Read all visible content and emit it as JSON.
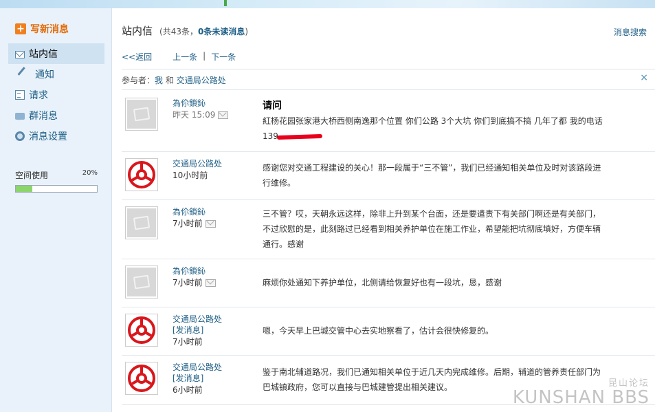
{
  "sidebar": {
    "compose_label": "写新消息",
    "items": [
      {
        "label": "站内信",
        "icon": "mail-icon",
        "active": true
      },
      {
        "label": "通知",
        "icon": "pencil-icon",
        "active": false
      },
      {
        "label": "请求",
        "icon": "document-icon",
        "active": false
      },
      {
        "label": "群消息",
        "icon": "chat-icon",
        "active": false
      },
      {
        "label": "消息设置",
        "icon": "settings-icon",
        "active": false
      }
    ],
    "space": {
      "label": "空间使用",
      "percent_label": "20%",
      "percent": 20
    }
  },
  "header": {
    "title": "站内信",
    "count_prefix": "(共43条，",
    "count_unread": "0条未读消息",
    "count_suffix": ")",
    "search_label": "消息搜索"
  },
  "pager": {
    "back": "<<返回",
    "prev": "上一条",
    "sep": "|",
    "next": "下一条"
  },
  "participants": {
    "label": "参与者：",
    "me": "我",
    "and": "和",
    "other": "交通局公路处",
    "close": "×"
  },
  "messages": [
    {
      "sender": "為伱鎖鈊",
      "avatar": "placeholder",
      "send_msg": "",
      "time": "昨天 15:09",
      "time_grey": true,
      "envelope": true,
      "subject": "请问",
      "body": "紅杨花园张家港大桥西侧南逸那个位置 你们公路 3个大坑 你们到底搞不搞  几年了都   我的电话 139",
      "redacted": true
    },
    {
      "sender": "交通局公路处",
      "avatar": "bureau",
      "send_msg": "",
      "time": "10小时前",
      "time_grey": false,
      "envelope": false,
      "subject": "",
      "body": "感谢您对交通工程建设的关心！那一段属于“三不管”，我们已经通知相关单位及时对该路段进行维修。",
      "redacted": false
    },
    {
      "sender": "為伱鎖鈊",
      "avatar": "placeholder",
      "send_msg": "",
      "time": "7小时前",
      "time_grey": false,
      "envelope": true,
      "subject": "",
      "body": "三不管？哎，天朝永远这样，除非上升到某个台面，还是要遣责下有关部门啊还是有关部门，不过欣慰的是，此刻路过已经看到相关养护单位在施工作业，希望能把坑彻底填好，方便车辆通行。感谢",
      "redacted": false
    },
    {
      "sender": "為伱鎖鈊",
      "avatar": "placeholder",
      "send_msg": "",
      "time": "7小时前",
      "time_grey": false,
      "envelope": true,
      "subject": "",
      "body": "麻烦你处通知下养护单位，北侧请给恢复好也有一段坑，恳，感谢",
      "redacted": false
    },
    {
      "sender": "交通局公路处",
      "avatar": "bureau",
      "send_msg": "[发消息]",
      "time": "7小时前",
      "time_grey": false,
      "envelope": false,
      "subject": "",
      "body": "嗯，今天早上巴城交管中心去实地察看了，估计会很快修复的。",
      "redacted": false
    },
    {
      "sender": "交通局公路处",
      "avatar": "bureau",
      "send_msg": "[发消息]",
      "time": "6小时前",
      "time_grey": false,
      "envelope": false,
      "subject": "",
      "body": "鉴于南北辅道路况，我们已通知相关单位于近几天内完成维修。后期，辅道的管养责任部门为巴城镇政府，您可以直接与巴城建管提出相关建议。",
      "redacted": false
    }
  ],
  "watermark": {
    "top": "昆山论坛",
    "main": "KUNSHAN BBS"
  }
}
